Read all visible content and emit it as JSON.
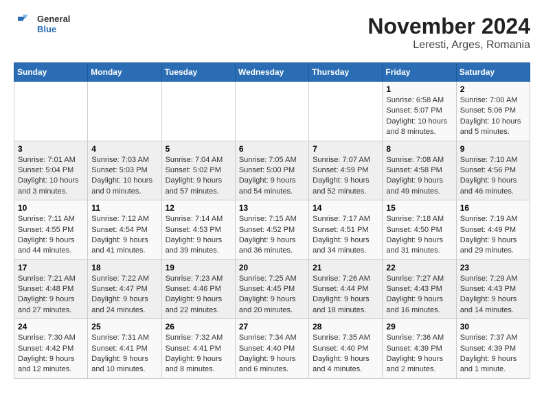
{
  "logo": {
    "general": "General",
    "blue": "Blue"
  },
  "title": "November 2024",
  "subtitle": "Leresti, Arges, Romania",
  "weekdays": [
    "Sunday",
    "Monday",
    "Tuesday",
    "Wednesday",
    "Thursday",
    "Friday",
    "Saturday"
  ],
  "weeks": [
    [
      {
        "day": "",
        "info": ""
      },
      {
        "day": "",
        "info": ""
      },
      {
        "day": "",
        "info": ""
      },
      {
        "day": "",
        "info": ""
      },
      {
        "day": "",
        "info": ""
      },
      {
        "day": "1",
        "info": "Sunrise: 6:58 AM\nSunset: 5:07 PM\nDaylight: 10 hours and 8 minutes."
      },
      {
        "day": "2",
        "info": "Sunrise: 7:00 AM\nSunset: 5:06 PM\nDaylight: 10 hours and 5 minutes."
      }
    ],
    [
      {
        "day": "3",
        "info": "Sunrise: 7:01 AM\nSunset: 5:04 PM\nDaylight: 10 hours and 3 minutes."
      },
      {
        "day": "4",
        "info": "Sunrise: 7:03 AM\nSunset: 5:03 PM\nDaylight: 10 hours and 0 minutes."
      },
      {
        "day": "5",
        "info": "Sunrise: 7:04 AM\nSunset: 5:02 PM\nDaylight: 9 hours and 57 minutes."
      },
      {
        "day": "6",
        "info": "Sunrise: 7:05 AM\nSunset: 5:00 PM\nDaylight: 9 hours and 54 minutes."
      },
      {
        "day": "7",
        "info": "Sunrise: 7:07 AM\nSunset: 4:59 PM\nDaylight: 9 hours and 52 minutes."
      },
      {
        "day": "8",
        "info": "Sunrise: 7:08 AM\nSunset: 4:58 PM\nDaylight: 9 hours and 49 minutes."
      },
      {
        "day": "9",
        "info": "Sunrise: 7:10 AM\nSunset: 4:56 PM\nDaylight: 9 hours and 46 minutes."
      }
    ],
    [
      {
        "day": "10",
        "info": "Sunrise: 7:11 AM\nSunset: 4:55 PM\nDaylight: 9 hours and 44 minutes."
      },
      {
        "day": "11",
        "info": "Sunrise: 7:12 AM\nSunset: 4:54 PM\nDaylight: 9 hours and 41 minutes."
      },
      {
        "day": "12",
        "info": "Sunrise: 7:14 AM\nSunset: 4:53 PM\nDaylight: 9 hours and 39 minutes."
      },
      {
        "day": "13",
        "info": "Sunrise: 7:15 AM\nSunset: 4:52 PM\nDaylight: 9 hours and 36 minutes."
      },
      {
        "day": "14",
        "info": "Sunrise: 7:17 AM\nSunset: 4:51 PM\nDaylight: 9 hours and 34 minutes."
      },
      {
        "day": "15",
        "info": "Sunrise: 7:18 AM\nSunset: 4:50 PM\nDaylight: 9 hours and 31 minutes."
      },
      {
        "day": "16",
        "info": "Sunrise: 7:19 AM\nSunset: 4:49 PM\nDaylight: 9 hours and 29 minutes."
      }
    ],
    [
      {
        "day": "17",
        "info": "Sunrise: 7:21 AM\nSunset: 4:48 PM\nDaylight: 9 hours and 27 minutes."
      },
      {
        "day": "18",
        "info": "Sunrise: 7:22 AM\nSunset: 4:47 PM\nDaylight: 9 hours and 24 minutes."
      },
      {
        "day": "19",
        "info": "Sunrise: 7:23 AM\nSunset: 4:46 PM\nDaylight: 9 hours and 22 minutes."
      },
      {
        "day": "20",
        "info": "Sunrise: 7:25 AM\nSunset: 4:45 PM\nDaylight: 9 hours and 20 minutes."
      },
      {
        "day": "21",
        "info": "Sunrise: 7:26 AM\nSunset: 4:44 PM\nDaylight: 9 hours and 18 minutes."
      },
      {
        "day": "22",
        "info": "Sunrise: 7:27 AM\nSunset: 4:43 PM\nDaylight: 9 hours and 16 minutes."
      },
      {
        "day": "23",
        "info": "Sunrise: 7:29 AM\nSunset: 4:43 PM\nDaylight: 9 hours and 14 minutes."
      }
    ],
    [
      {
        "day": "24",
        "info": "Sunrise: 7:30 AM\nSunset: 4:42 PM\nDaylight: 9 hours and 12 minutes."
      },
      {
        "day": "25",
        "info": "Sunrise: 7:31 AM\nSunset: 4:41 PM\nDaylight: 9 hours and 10 minutes."
      },
      {
        "day": "26",
        "info": "Sunrise: 7:32 AM\nSunset: 4:41 PM\nDaylight: 9 hours and 8 minutes."
      },
      {
        "day": "27",
        "info": "Sunrise: 7:34 AM\nSunset: 4:40 PM\nDaylight: 9 hours and 6 minutes."
      },
      {
        "day": "28",
        "info": "Sunrise: 7:35 AM\nSunset: 4:40 PM\nDaylight: 9 hours and 4 minutes."
      },
      {
        "day": "29",
        "info": "Sunrise: 7:36 AM\nSunset: 4:39 PM\nDaylight: 9 hours and 2 minutes."
      },
      {
        "day": "30",
        "info": "Sunrise: 7:37 AM\nSunset: 4:39 PM\nDaylight: 9 hours and 1 minute."
      }
    ]
  ]
}
